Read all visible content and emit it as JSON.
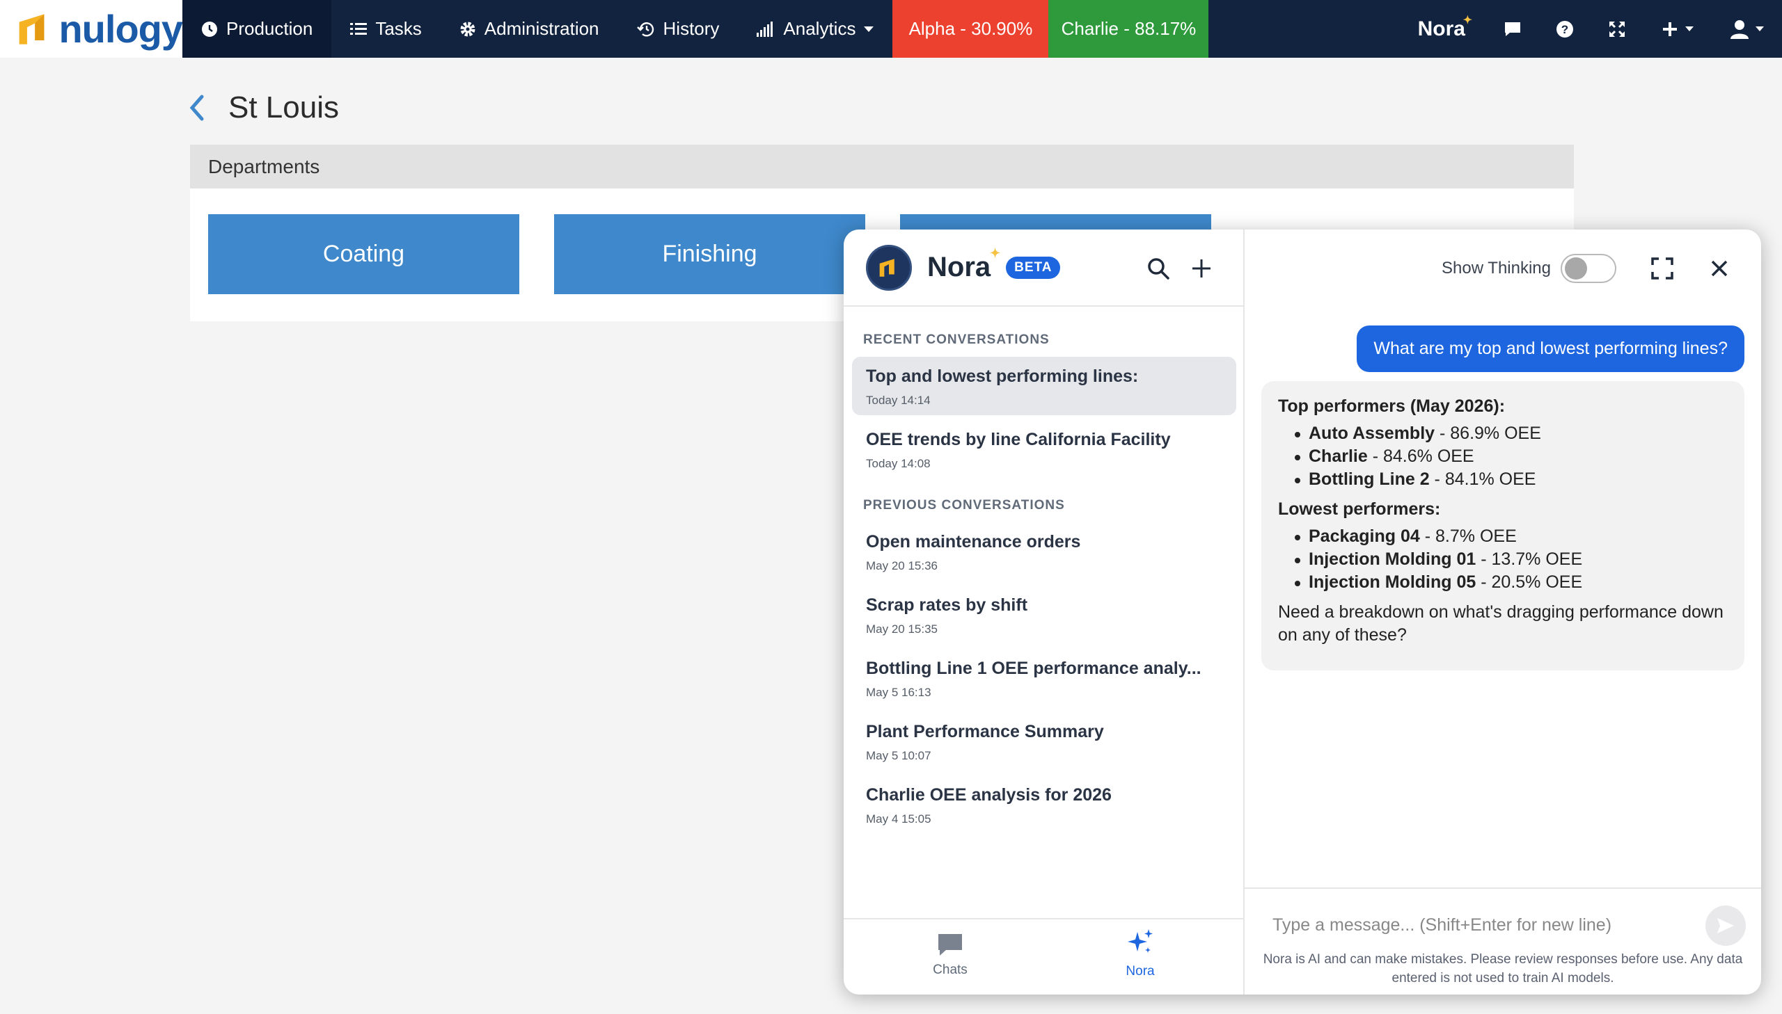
{
  "topnav": {
    "logo_text": "nulogy",
    "items": [
      {
        "label": "Production",
        "icon": "clock-icon"
      },
      {
        "label": "Tasks",
        "icon": "list-icon"
      },
      {
        "label": "Administration",
        "icon": "gear-icon"
      },
      {
        "label": "History",
        "icon": "history-icon"
      },
      {
        "label": "Analytics",
        "icon": "bar-chart-icon"
      }
    ],
    "kpis": [
      {
        "label": "Alpha - 30.90%",
        "color": "#ec412f"
      },
      {
        "label": "Charlie - 88.17%",
        "color": "#2e9a3c"
      }
    ],
    "nora_label": "Nora"
  },
  "page": {
    "title": "St Louis",
    "departments_label": "Departments",
    "departments": [
      "Coating",
      "Finishing"
    ]
  },
  "nora": {
    "title": "Nora",
    "beta": "BETA",
    "recent_label": "RECENT CONVERSATIONS",
    "previous_label": "PREVIOUS CONVERSATIONS",
    "recent": [
      {
        "title": "Top and lowest performing lines:",
        "time": "Today 14:14"
      },
      {
        "title": "OEE trends by line California Facility",
        "time": "Today 14:08"
      }
    ],
    "previous": [
      {
        "title": "Open maintenance orders",
        "time": "May 20 15:36"
      },
      {
        "title": "Scrap rates by shift",
        "time": "May 20 15:35"
      },
      {
        "title": "Bottling Line 1 OEE performance analy...",
        "time": "May 5 16:13"
      },
      {
        "title": "Plant Performance Summary",
        "time": "May 5 10:07"
      },
      {
        "title": "Charlie OEE analysis for 2026",
        "time": "May 4 15:05"
      }
    ],
    "tabs": {
      "chats": "Chats",
      "nora": "Nora"
    },
    "show_thinking": "Show Thinking",
    "user_message": "What are my top and lowest performing lines?",
    "reply": {
      "top_heading": "Top performers (May 2026):",
      "top": [
        {
          "name": "Auto Assembly",
          "value": " - 86.9% OEE"
        },
        {
          "name": "Charlie",
          "value": " - 84.6% OEE"
        },
        {
          "name": "Bottling Line 2",
          "value": " - 84.1% OEE"
        }
      ],
      "low_heading": "Lowest performers:",
      "low": [
        {
          "name": "Packaging 04",
          "value": " - 8.7% OEE"
        },
        {
          "name": "Injection Molding 01",
          "value": " - 13.7% OEE"
        },
        {
          "name": "Injection Molding 05",
          "value": " - 20.5% OEE"
        }
      ],
      "closing": "Need a breakdown on what's dragging performance down on any of these?"
    },
    "composer_placeholder": "Type a message... (Shift+Enter for new line)",
    "disclaimer": "Nora is AI and can make mistakes. Please review responses before use. Any data entered is not used to train AI models."
  }
}
